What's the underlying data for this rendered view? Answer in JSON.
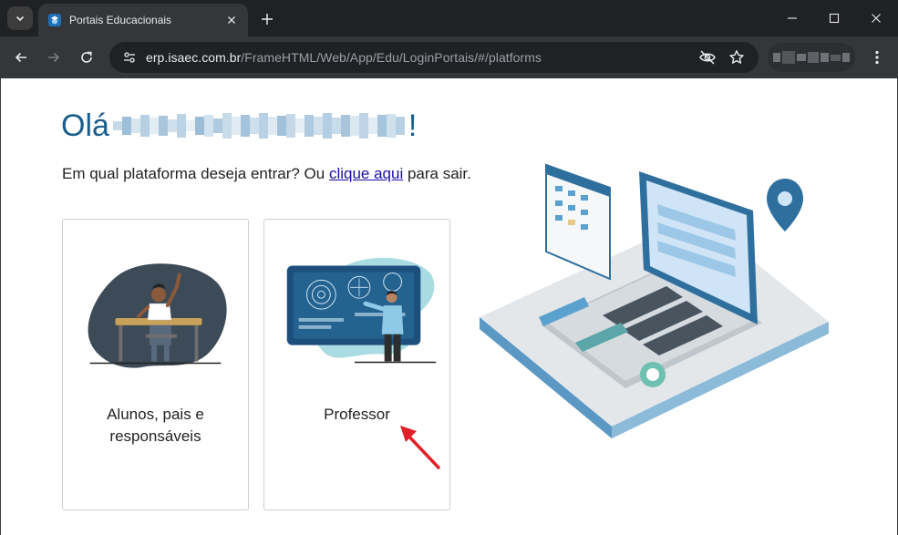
{
  "browser": {
    "tab_title": "Portais Educacionais",
    "url_domain": "erp.isaec.com.br",
    "url_path": "/FrameHTML/Web/App/Edu/LoginPortais/#/platforms"
  },
  "page": {
    "greeting_prefix": "Olá",
    "greeting_suffix": "!",
    "question_text": "Em qual plataforma deseja entrar? Ou ",
    "question_link": "clique aqui",
    "question_tail": " para sair.",
    "cards": [
      {
        "label_line1": "Alunos, pais e",
        "label_line2": "responsáveis"
      },
      {
        "label_line1": "Professor"
      }
    ]
  },
  "colors": {
    "accent": "#1b5e8c",
    "link": "#1a0dab",
    "arrow": "#e0202a"
  }
}
